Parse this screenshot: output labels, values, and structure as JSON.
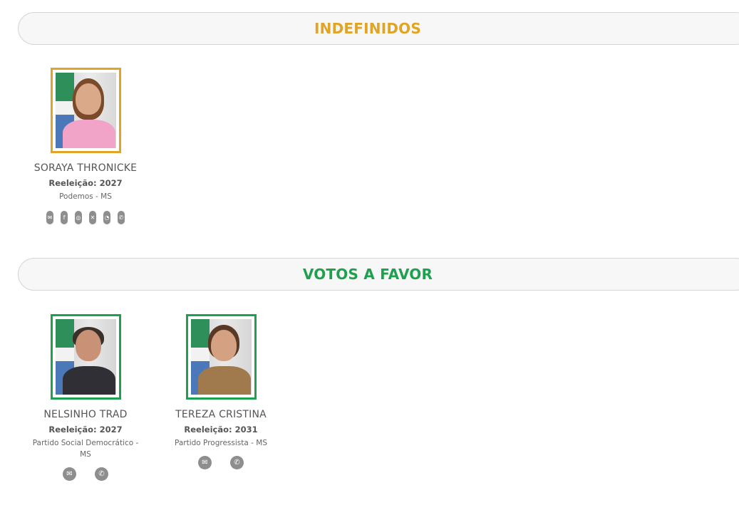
{
  "sections": [
    {
      "title": "INDEFINIDOS",
      "color": "#e0a526",
      "members": [
        {
          "name": "SORAYA THRONICKE",
          "reelection": "Reeleição: 2027",
          "party": "Podemos - MS",
          "contacts": [
            "email-icon",
            "facebook-icon",
            "instagram-icon",
            "x-icon",
            "whatsapp-icon",
            "phone-icon"
          ]
        }
      ]
    },
    {
      "title": "VOTOS A FAVOR",
      "color": "#1fa04f",
      "members": [
        {
          "name": "NELSINHO TRAD",
          "reelection": "Reeleição: 2027",
          "party": "Partido Social Democrático - MS",
          "contacts": [
            "email-icon",
            "phone-icon"
          ]
        },
        {
          "name": "TEREZA CRISTINA",
          "reelection": "Reeleição: 2031",
          "party": "Partido Progressista - MS",
          "contacts": [
            "email-icon",
            "phone-icon"
          ]
        }
      ]
    }
  ]
}
